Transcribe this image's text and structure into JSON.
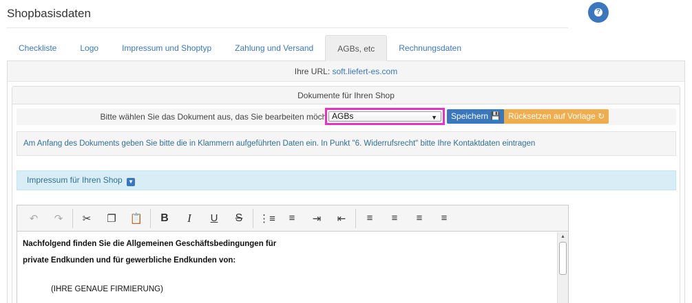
{
  "header": {
    "title": "Shopbasisdaten",
    "help_icon": "question-icon"
  },
  "tabs": [
    {
      "label": "Checkliste",
      "active": false
    },
    {
      "label": "Logo",
      "active": false
    },
    {
      "label": "Impressum und Shoptyp",
      "active": false
    },
    {
      "label": "Zahlung und Versand",
      "active": false
    },
    {
      "label": "AGBs, etc",
      "active": true
    },
    {
      "label": "Rechnungsdaten",
      "active": false
    }
  ],
  "url_bar": {
    "label": "Ihre URL:",
    "url": "soft.liefert-es.com"
  },
  "documents_panel": {
    "title": "Dokumente für Ihren Shop",
    "select_label": "Bitte wählen Sie das Dokument aus, das Sie bearbeiten möchten",
    "select_value": "AGBs",
    "save_label": "Speichern",
    "reset_label": "Rücksetzen auf Vorlage",
    "info_text": "Am Anfang des Dokuments geben Sie bitte die in Klammern aufgeführten Daten ein. In Punkt \"6. Widerrufsrecht\" bitte Ihre Kontaktdaten eintragen",
    "impressum_label": "Impressum für Ihren Shop"
  },
  "editor": {
    "toolbar_icons": [
      "undo-icon",
      "redo-icon",
      "cut-icon",
      "copy-icon",
      "paste-icon",
      "bold-icon",
      "italic-icon",
      "underline-icon",
      "strikethrough-icon",
      "bullet-list-icon",
      "numbered-list-icon",
      "indent-icon",
      "outdent-icon",
      "align-left-icon",
      "align-right-icon",
      "align-center-icon",
      "align-justify-icon"
    ],
    "content": {
      "line1": "Nachfolgend finden Sie die Allgemeinen Geschäftsbedingungen für",
      "line2": "private Endkunden und für gewerbliche Endkunden von:",
      "line3": "(IHRE GENAUE FIRMIERUNG)"
    }
  },
  "colors": {
    "primary": "#3a77bf",
    "warning": "#f0ad4e",
    "highlight": "#e832c6",
    "info_bg": "#d9edf7"
  }
}
